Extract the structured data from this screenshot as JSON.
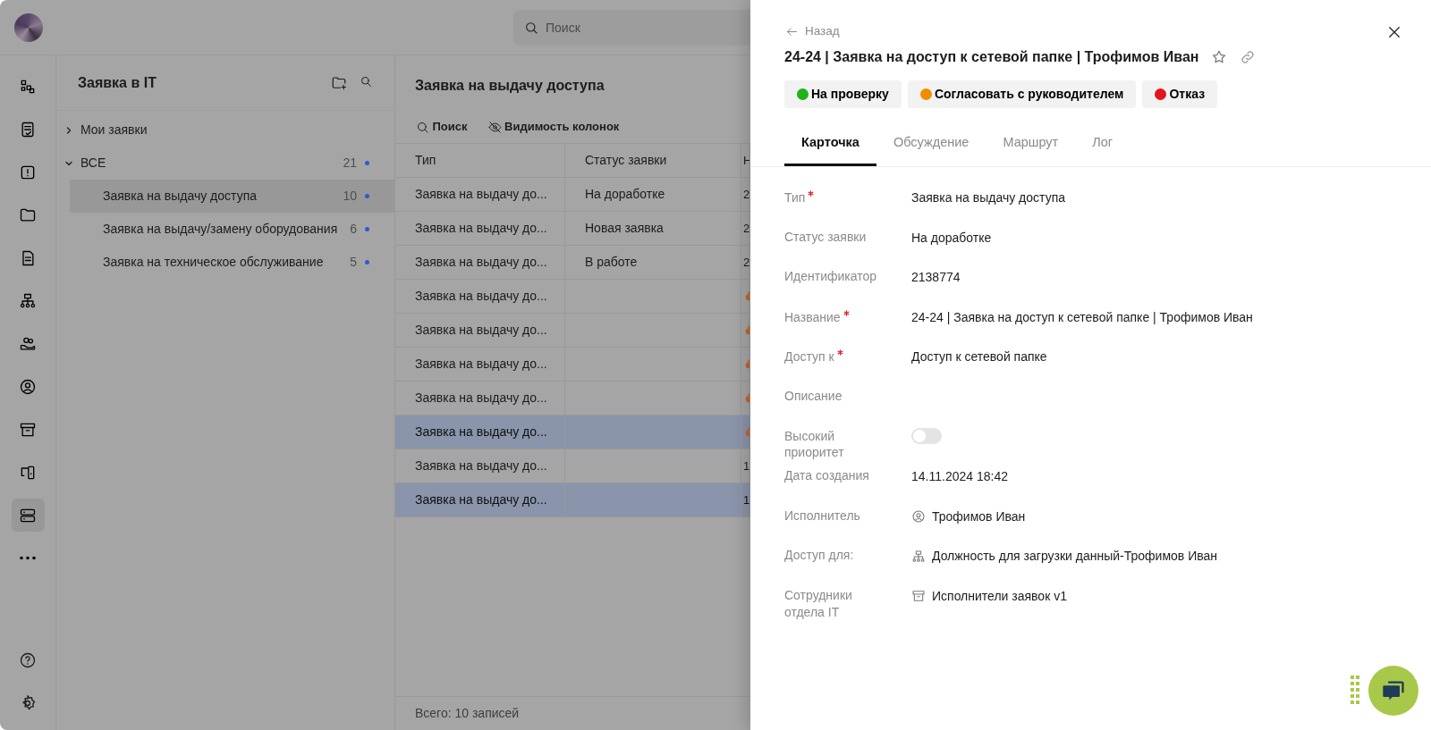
{
  "topbar": {
    "search": {
      "placeholder": "Поиск"
    }
  },
  "rail": [
    {
      "selected": false
    },
    {
      "selected": false
    },
    {
      "selected": false
    },
    {
      "selected": false
    },
    {
      "selected": false
    },
    {
      "selected": false
    },
    {
      "selected": false
    },
    {
      "selected": false
    },
    {
      "selected": false
    },
    {
      "selected": false
    },
    {
      "selected": true
    },
    {
      "selected": false
    }
  ],
  "tree": {
    "title": "Заявка в IT",
    "items": [
      {
        "label": "Мои заявки",
        "expanded": false,
        "selected": false
      },
      {
        "label": "ВСЕ",
        "count": "21",
        "expanded": true,
        "selected": false,
        "children": [
          {
            "label": "Заявка на выдачу доступа",
            "count": "10",
            "selected": true
          },
          {
            "label": "Заявка на выдачу/замену оборудования",
            "count": "6",
            "selected": false
          },
          {
            "label": "Заявка на техническое обслуживание",
            "count": "5",
            "selected": false
          }
        ]
      }
    ]
  },
  "table": {
    "title": "Заявка на выдачу доступа",
    "toolbar": [
      "Поиск",
      "Видимость колонок"
    ],
    "columns": [
      "Тип",
      "Статус заявки",
      "Н"
    ],
    "rows": [
      {
        "cells": [
          "Заявка на выдачу до...",
          "На доработке",
          "2"
        ],
        "selected": false
      },
      {
        "cells": [
          "Заявка на выдачу до...",
          "Новая заявка",
          "2"
        ],
        "selected": false
      },
      {
        "cells": [
          "Заявка на выдачу до...",
          "В работе",
          "2"
        ],
        "selected": false
      },
      {
        "cells": [
          "Заявка на выдачу до..."
        ],
        "selected": false
      },
      {
        "cells": [
          "Заявка на выдачу до..."
        ],
        "selected": false
      },
      {
        "cells": [
          "Заявка на выдачу до..."
        ],
        "selected": false
      },
      {
        "cells": [
          "Заявка на выдачу до..."
        ],
        "selected": false
      },
      {
        "cells": [
          "Заявка на выдачу до..."
        ],
        "selected": true
      },
      {
        "cells": [
          "Заявка на выдачу до...",
          "",
          "1"
        ],
        "selected": false
      },
      {
        "cells": [
          "Заявка на выдачу до...",
          "",
          "1"
        ],
        "selected": true
      }
    ],
    "footer": "Всего: 10 записей"
  },
  "panel": {
    "back": "Назад",
    "title": "24-24 | Заявка на доступ к сетевой папке | Трофимов Иван",
    "actions": [
      {
        "label": "На проверку",
        "color": "#1fb318"
      },
      {
        "label": "Согласовать с руководителем",
        "color": "#f08c00"
      },
      {
        "label": "Отказ",
        "color": "#e0161c"
      }
    ],
    "tabs": [
      {
        "label": "Карточка",
        "selected": true
      },
      {
        "label": "Обсуждение",
        "selected": false
      },
      {
        "label": "Маршрут",
        "selected": false
      },
      {
        "label": "Лог",
        "selected": false
      }
    ],
    "fields": [
      {
        "label": "Тип",
        "required": true,
        "kind": "text",
        "value": "Заявка на выдачу доступа"
      },
      {
        "label": "Статус заявки",
        "required": false,
        "kind": "text",
        "value": "На доработке"
      },
      {
        "label": "Идентификатор",
        "required": false,
        "kind": "text",
        "value": "2138774"
      },
      {
        "label": "Название",
        "required": true,
        "kind": "text",
        "value": "24-24 | Заявка на доступ к сетевой папке | Трофимов Иван"
      },
      {
        "label": "Доступ к",
        "required": true,
        "kind": "text",
        "value": "Доступ к сетевой папке"
      },
      {
        "label": "Описание",
        "required": false,
        "kind": "text"
      },
      {
        "label": "Высокий приоритет",
        "required": false,
        "kind": "toggle",
        "on": false
      },
      {
        "label": "Дата создания",
        "required": false,
        "kind": "text",
        "value": "14.11.2024 18:42"
      },
      {
        "label": "Исполнитель",
        "required": false,
        "kind": "user",
        "value": "Трофимов Иван"
      },
      {
        "label": "Доступ для:",
        "required": false,
        "kind": "org",
        "value": "Должность для загрузки данный-Трофимов Иван"
      },
      {
        "label": "Сотрудники отдела IT",
        "required": false,
        "kind": "group",
        "value": "Исполнители заявок v1"
      }
    ]
  }
}
